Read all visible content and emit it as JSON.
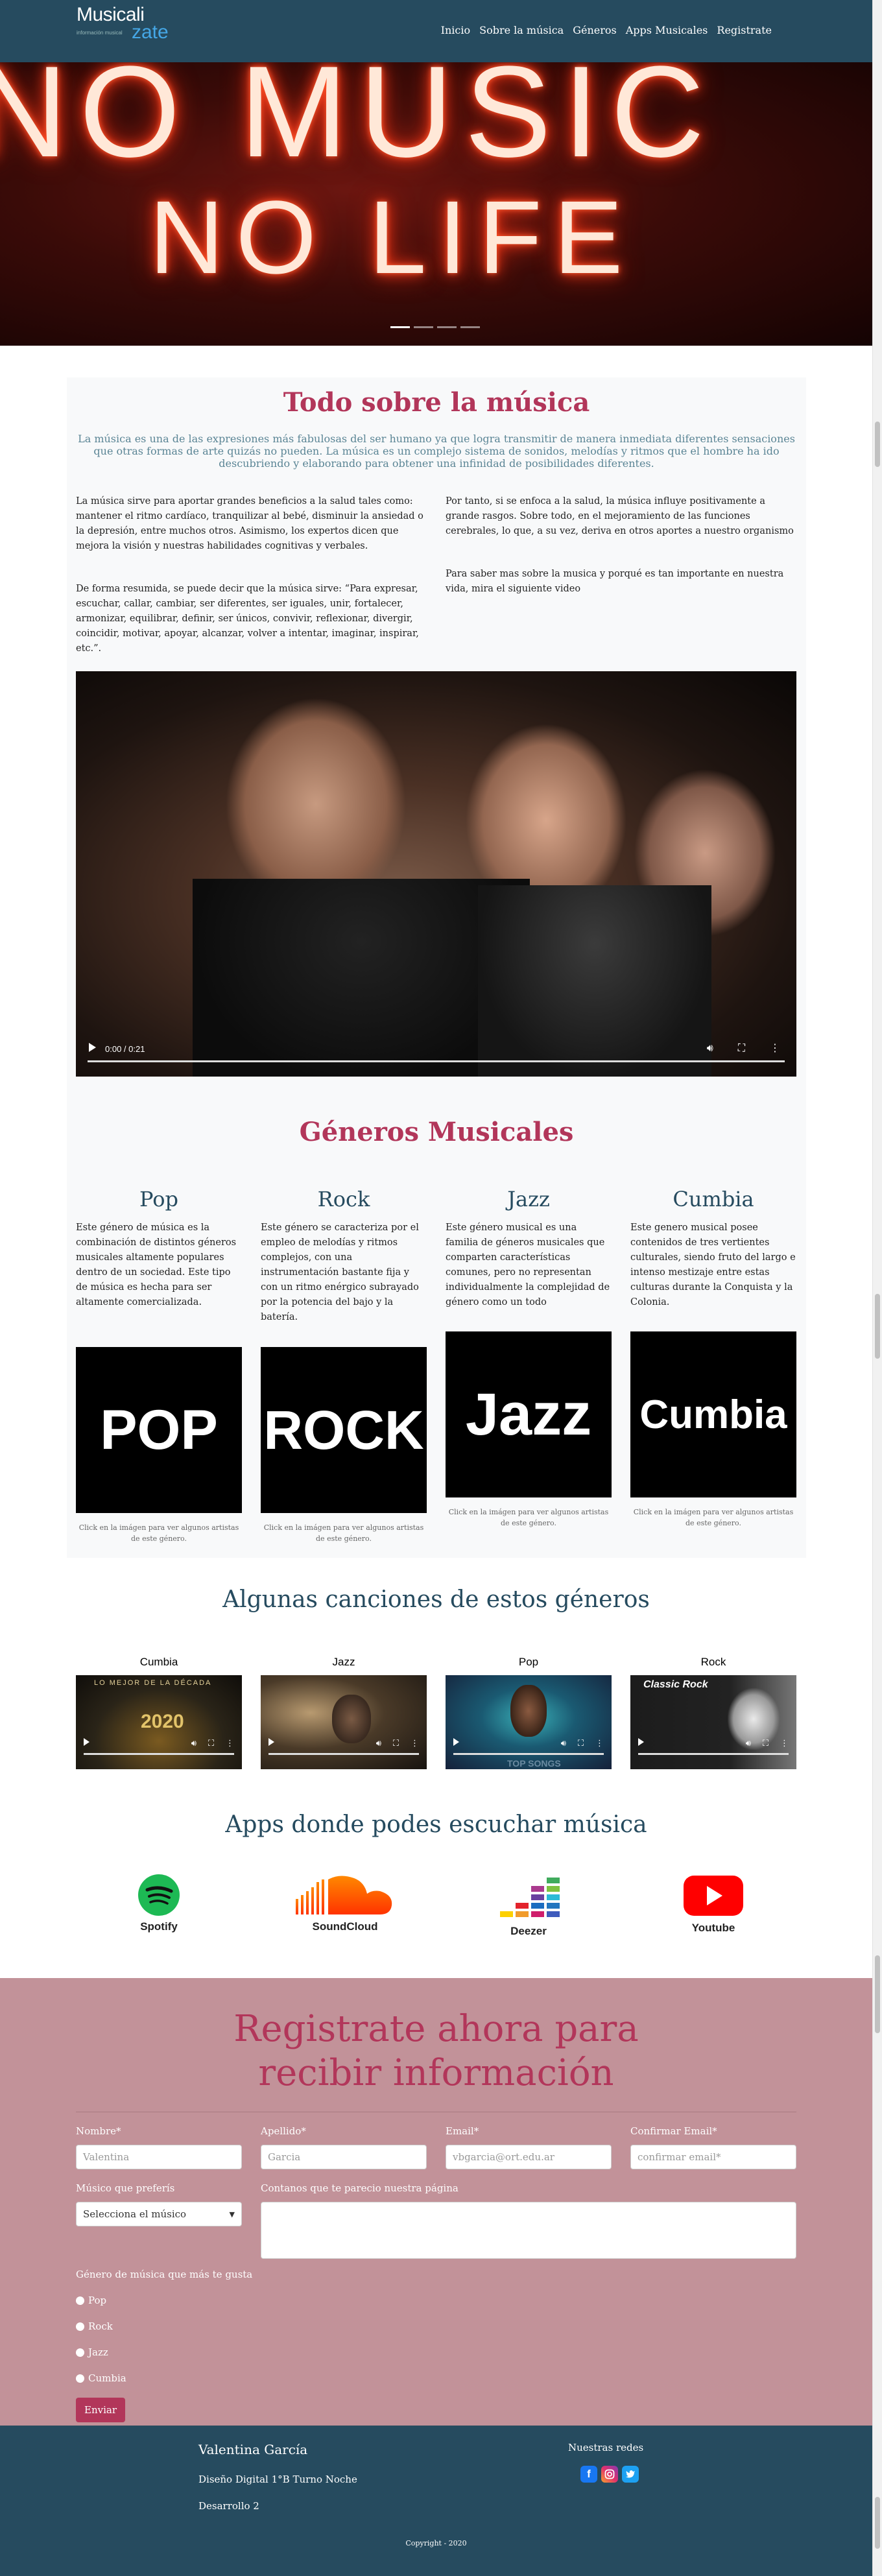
{
  "brand": {
    "line1": "Musicali",
    "line2": "zate",
    "tagline": "información musical"
  },
  "nav": {
    "items": [
      {
        "label": "Inicio"
      },
      {
        "label": "Sobre la música"
      },
      {
        "label": "Géneros"
      },
      {
        "label": "Apps Musicales"
      },
      {
        "label": "Registrate"
      }
    ]
  },
  "hero": {
    "line1": "NO MUSIC",
    "line2": "NO LIFE"
  },
  "about": {
    "title": "Todo sobre la música",
    "lead": "La música es una de las expresiones más fabulosas del ser humano ya que logra transmitir de manera inmediata diferentes sensaciones que otras formas de arte quizás no pueden. La música es un complejo sistema de sonidos, melodías y ritmos que el hombre ha ido descubriendo y elaborando para obtener una infinidad de posibilidades diferentes.",
    "left_p1": "La música sirve para aportar grandes beneficios a la salud tales como: mantener el ritmo cardíaco, tranquilizar al bebé, disminuir la ansiedad o la depresión, entre muchos otros. Asimismo, los expertos dicen que mejora la visión y nuestras habilidades cognitivas y verbales.",
    "left_p2": "De forma resumida, se puede decir que la música sirve: “Para expresar, escuchar, callar, cambiar, ser diferentes, ser iguales, unir, fortalecer, armonizar, equilibrar, definir, ser únicos, convivir, reflexionar, divergir, coincidir, motivar, apoyar, alcanzar, volver a intentar, imaginar, inspirar, etc.”.",
    "right_p1": "Por tanto, si se enfoca a la salud, la música influye positivamente a grande rasgos. Sobre todo, en el mejoramiento de las funciones cerebrales, lo que, a su vez, deriva en otros aportes a nuestro organismo",
    "right_p2": "Para saber mas sobre la musica y porqué es tan importante en nuestra vida, mira el siguiente video",
    "video_time": "0:00 / 0:21"
  },
  "genres": {
    "title": "Géneros Musicales",
    "items": [
      {
        "name": "Pop",
        "desc": "Este género de música es la combinación de distintos géneros musicales altamente populares dentro de un sociedad. Este tipo de música es hecha para ser altamente comercializada.",
        "img_text": "POP",
        "caption": "Click en la imágen para ver algunos artistas de este género."
      },
      {
        "name": "Rock",
        "desc": "Este género se caracteriza por el empleo de melodías y ritmos complejos, con una instrumentación bastante fija y con un ritmo enérgico subrayado por la potencia del bajo y la batería.",
        "img_text": "ROCK",
        "caption": "Click en la imágen para ver algunos artistas de este género."
      },
      {
        "name": "Jazz",
        "desc": "Este género musical es una familia de géneros musicales que comparten características comunes, pero no representan individualmente la complejidad de género como un todo",
        "img_text": "Jazz",
        "caption": "Click en la imágen para ver algunos artistas de este género."
      },
      {
        "name": "Cumbia",
        "desc": "Este genero musical posee contenidos de tres vertientes culturales, siendo fruto del largo e intenso mestizaje entre estas culturas durante la Conquista y la Colonia.",
        "img_text": "Cumbia",
        "caption": "Click en la imágen para ver algunos artistas de este género."
      }
    ]
  },
  "songs": {
    "title": "Algunas canciones de estos géneros",
    "items": [
      {
        "label": "Cumbia",
        "overlay": "LO MEJOR DE LA DÉCADA",
        "overlay2": "2020"
      },
      {
        "label": "Jazz",
        "overlay": "",
        "overlay2": ""
      },
      {
        "label": "Pop",
        "overlay": "TOP SONGS",
        "overlay2": ""
      },
      {
        "label": "Rock",
        "overlay": "Classic Rock",
        "overlay2": ""
      }
    ]
  },
  "apps": {
    "title": "Apps donde podes escuchar música",
    "items": [
      {
        "label": "Spotify"
      },
      {
        "label": "SoundCloud"
      },
      {
        "label": "Deezer"
      },
      {
        "label": "Youtube"
      }
    ]
  },
  "register": {
    "title": "Registrate ahora para recibir información",
    "fields": {
      "nombre": {
        "label": "Nombre*",
        "value": "Valentina"
      },
      "apellido": {
        "label": "Apellido*",
        "value": "Garcia"
      },
      "email": {
        "label": "Email*",
        "value": "vbgarcia@ort.edu.ar"
      },
      "confirm": {
        "label": "Confirmar Email*",
        "placeholder": "confirmar email*"
      },
      "musico": {
        "label": "Músico que preferís",
        "value": "Selecciona el músico"
      },
      "comentario": {
        "label": "Contanos que te parecio nuestra página"
      }
    },
    "radio_label": "Género de música que más te gusta",
    "radios": [
      {
        "label": "Pop"
      },
      {
        "label": "Rock"
      },
      {
        "label": "Jazz"
      },
      {
        "label": "Cumbia"
      }
    ],
    "submit": "Enviar"
  },
  "footer": {
    "name": "Valentina García",
    "line2": "Diseño Digital 1°B Turno Noche",
    "line3": "Desarrollo 2",
    "social_title": "Nuestras redes",
    "copyright": "Copyright - 2020"
  },
  "colors": {
    "navy": "#264b5f",
    "accent": "#b2365a",
    "pink_bg": "#c29299",
    "grey_bg": "#f8f9fa"
  }
}
